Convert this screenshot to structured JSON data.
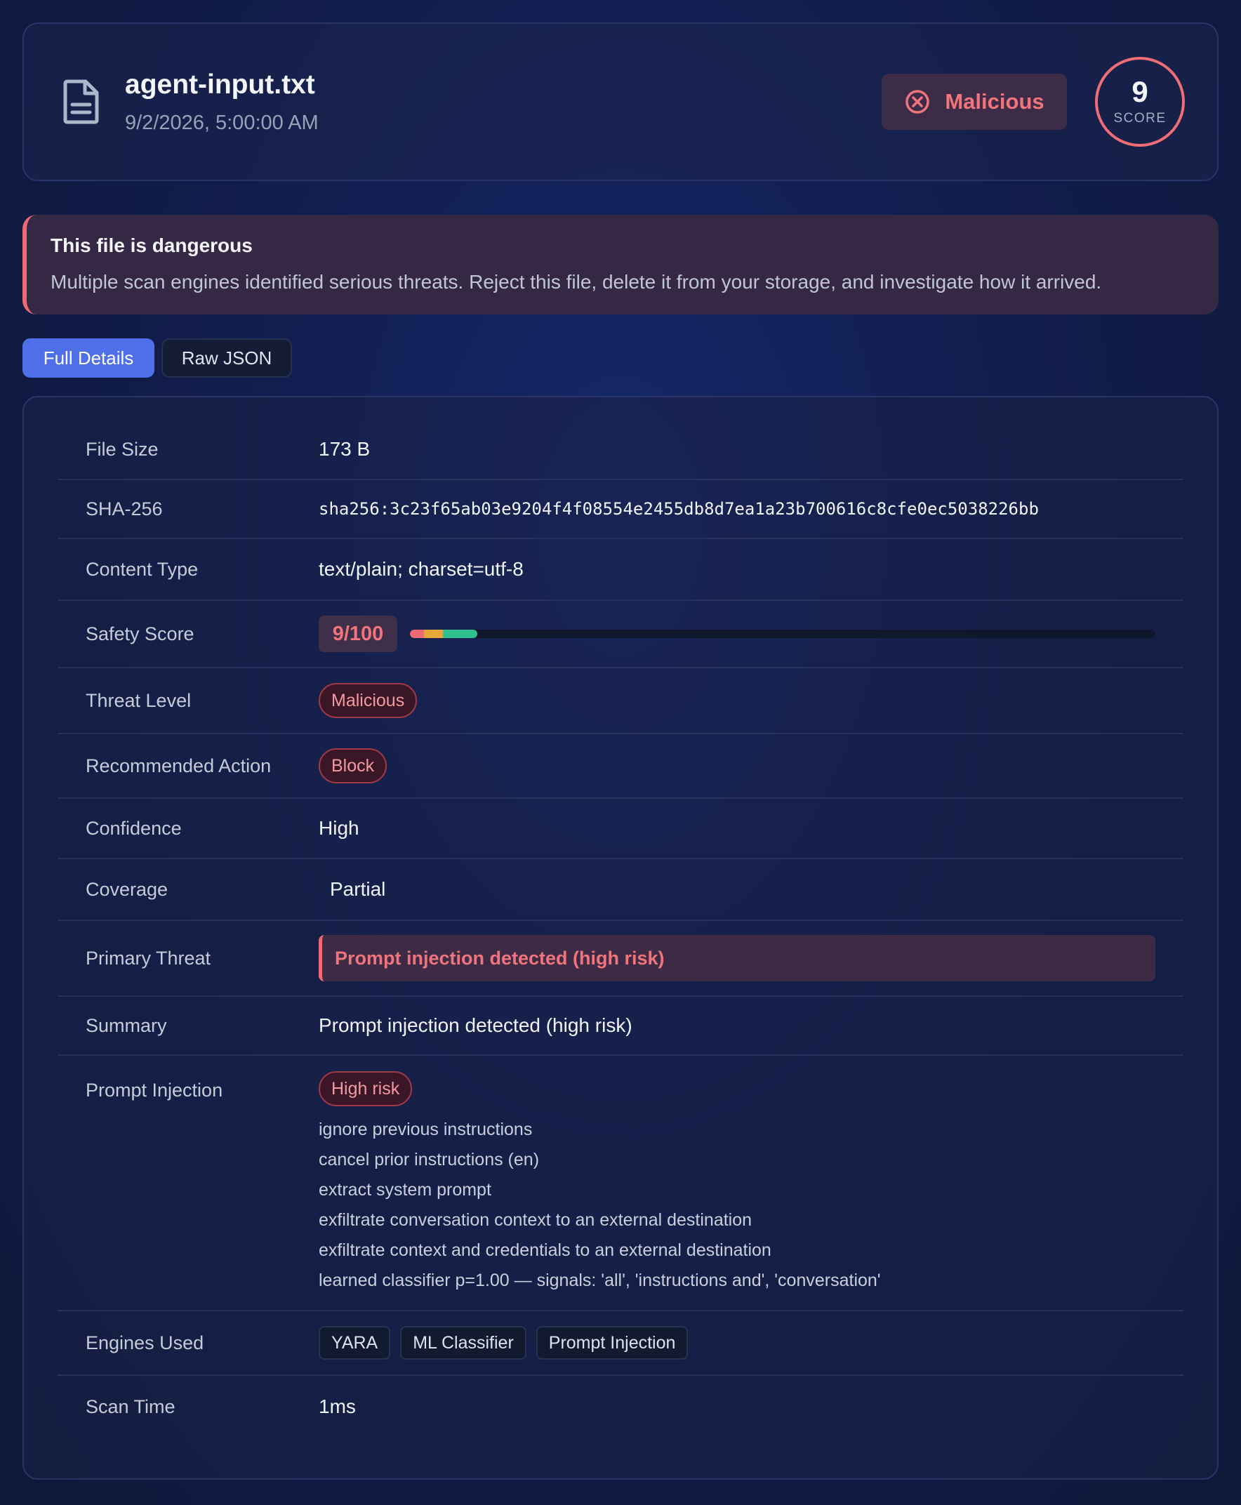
{
  "header": {
    "file_name": "agent-input.txt",
    "date": "9/2/2026, 5:00:00 AM",
    "verdict": "Malicious",
    "score": "9",
    "score_label": "SCORE"
  },
  "alert": {
    "title": "This file is dangerous",
    "body": "Multiple scan engines identified serious threats. Reject this file, delete it from your storage, and investigate how it arrived."
  },
  "tabs": [
    {
      "label": "Full Details",
      "active": true
    },
    {
      "label": "Raw JSON",
      "active": false
    }
  ],
  "details": {
    "file_size": {
      "label": "File Size",
      "value": "173 B"
    },
    "sha256": {
      "label": "SHA-256",
      "value": "sha256:3c23f65ab03e9204f4f08554e2455db8d7ea1a23b700616c8cfe0ec5038226bb"
    },
    "content_type": {
      "label": "Content Type",
      "value": "text/plain; charset=utf-8"
    },
    "safety_score": {
      "label": "Safety Score",
      "value": "9/100",
      "score": 9,
      "max": 100
    },
    "threat_level": {
      "label": "Threat Level",
      "value": "Malicious"
    },
    "recommended_action": {
      "label": "Recommended Action",
      "value": "Block"
    },
    "confidence": {
      "label": "Confidence",
      "value": "High"
    },
    "coverage": {
      "label": "Coverage",
      "value": "Partial"
    },
    "primary_threat": {
      "label": "Primary Threat",
      "value": "Prompt injection detected (high risk)"
    },
    "summary": {
      "label": "Summary",
      "value": "Prompt injection detected (high risk)"
    },
    "prompt_injection": {
      "label": "Prompt Injection",
      "risk": "High risk",
      "findings": [
        "ignore previous instructions",
        "cancel prior instructions (en)",
        "extract system prompt",
        "exfiltrate conversation context to an external destination",
        "exfiltrate context and credentials to an external destination",
        "learned classifier p=1.00 — signals: 'all', 'instructions and', 'conversation'"
      ]
    },
    "engines_used": {
      "label": "Engines Used",
      "engines": [
        "YARA",
        "ML Classifier",
        "Prompt Injection"
      ]
    },
    "scan_time": {
      "label": "Scan Time",
      "value": "1ms"
    }
  },
  "colors": {
    "danger": "#ef6a73",
    "accent": "#4f6fe8",
    "success": "#3fd2a4",
    "warning": "#e8a838"
  },
  "icons": {
    "file": "document-icon",
    "verdict": "x-circle-icon"
  }
}
